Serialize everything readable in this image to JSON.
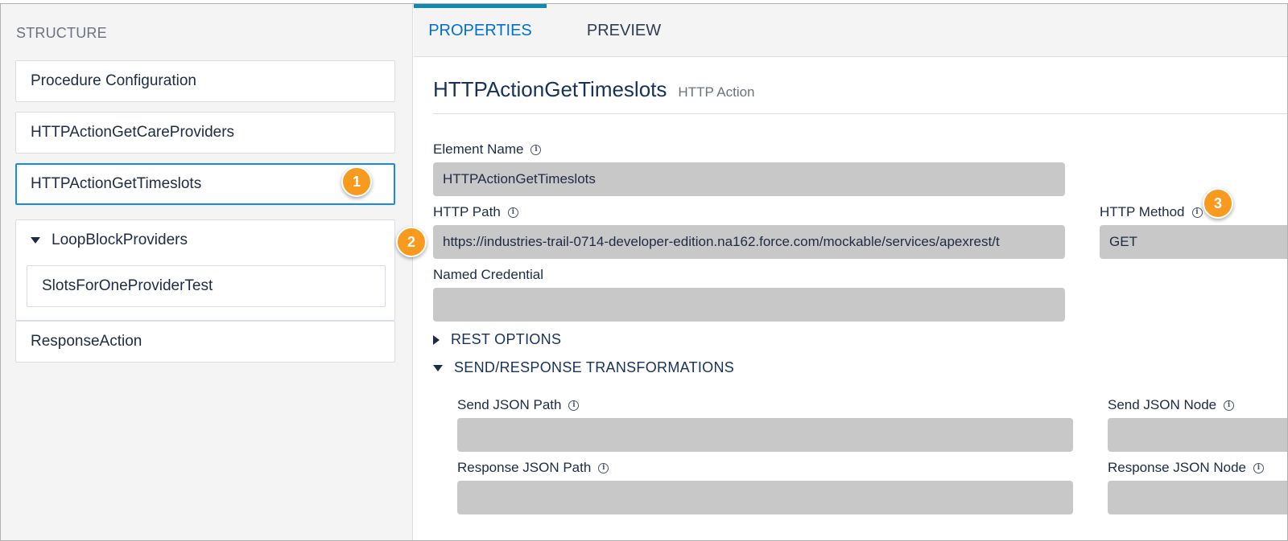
{
  "structure": {
    "title": "STRUCTURE",
    "items": [
      {
        "label": "Procedure Configuration"
      },
      {
        "label": "HTTPActionGetCareProviders"
      },
      {
        "label": "HTTPActionGetTimeslots"
      },
      {
        "label": "LoopBlockProviders",
        "child": "SlotsForOneProviderTest"
      },
      {
        "label": "ResponseAction"
      }
    ]
  },
  "tabs": [
    {
      "label": "PROPERTIES",
      "active": true
    },
    {
      "label": "PREVIEW",
      "active": false
    }
  ],
  "properties": {
    "title": "HTTPActionGetTimeslots",
    "subtitle": "HTTP Action",
    "element_name_label": "Element Name",
    "element_name_value": "HTTPActionGetTimeslots",
    "http_path_label": "HTTP Path",
    "http_path_value": "https://industries-trail-0714-developer-edition.na162.force.com/mockable/services/apexrest/t",
    "http_method_label": "HTTP Method",
    "http_method_value": "GET",
    "named_credential_label": "Named Credential",
    "named_credential_value": "",
    "rest_options_label": "REST OPTIONS",
    "transformations_label": "SEND/RESPONSE TRANSFORMATIONS",
    "send_json_path_label": "Send JSON Path",
    "send_json_node_label": "Send JSON Node",
    "response_json_path_label": "Response JSON Path",
    "response_json_node_label": "Response JSON Node"
  },
  "badges": [
    "1",
    "2",
    "3"
  ],
  "colors": {
    "accent": "#0070d2",
    "tab_indicator": "#0f8ab3",
    "badge": "#f79a1d",
    "field_bg": "#c8c8c8"
  },
  "icons": {
    "info": "info-circle-icon",
    "expand": "triangle-down-icon",
    "collapse": "triangle-right-icon"
  }
}
